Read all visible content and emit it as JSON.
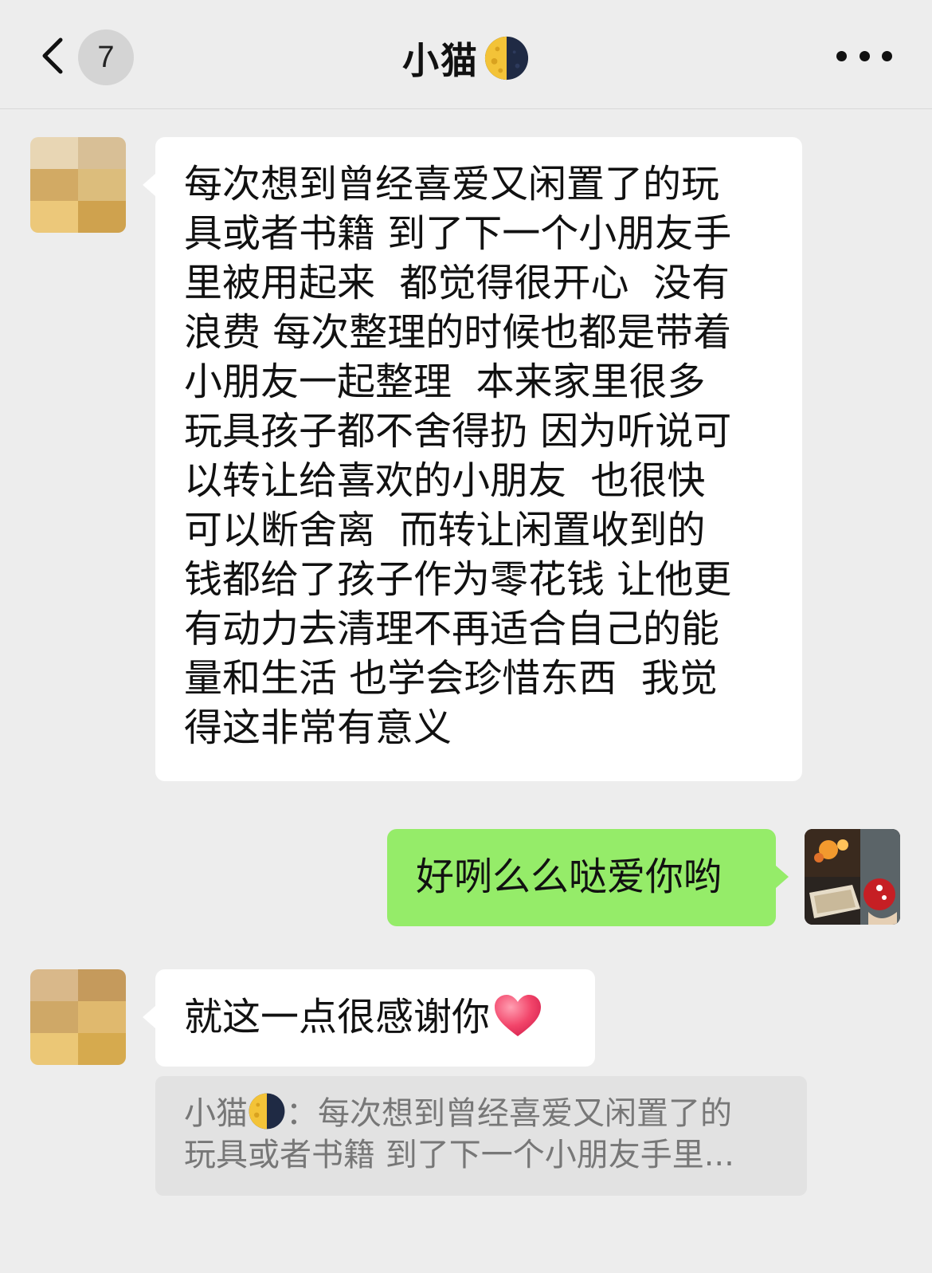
{
  "header": {
    "unread_count": "7",
    "title": "小猫",
    "title_icon": "moon-icon"
  },
  "messages": [
    {
      "side": "left",
      "avatar": "blurred-avatar",
      "text": "每次想到曾经喜爱又闲置了的玩\n具或者书籍 到了下一个小朋友手\n里被用起来  都觉得很开心  没有\n浪费 每次整理的时候也都是带着\n小朋友一起整理  本来家里很多\n玩具孩子都不舍得扔 因为听说可\n以转让给喜欢的小朋友  也很快\n可以断舍离  而转让闲置收到的\n钱都给了孩子作为零花钱 让他更\n有动力去清理不再适合自己的能\n量和生活 也学会珍惜东西  我觉\n得这非常有意义"
    },
    {
      "side": "right",
      "avatar": "photo-avatar",
      "text": "好咧么么哒爱你哟"
    },
    {
      "side": "left",
      "avatar": "blurred-avatar",
      "text": "就这一点很感谢你",
      "trailing_icon": "heart-icon"
    }
  ],
  "quote": {
    "sender": "小猫",
    "separator": "：",
    "line1": "每次想到曾经喜爱又闲置了的",
    "line2": "玩具或者书籍 到了下一个小朋友手里..."
  },
  "colors": {
    "background": "#ededed",
    "left_bubble": "#ffffff",
    "right_bubble": "#95ec69",
    "quote_bg": "#e2e2e2",
    "quote_text": "#777777"
  }
}
